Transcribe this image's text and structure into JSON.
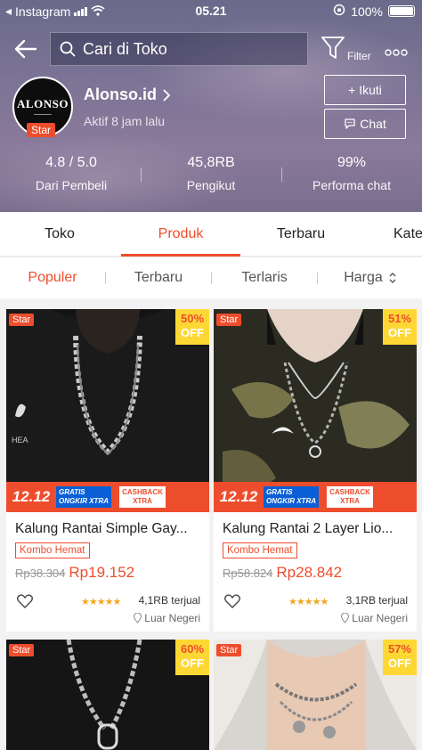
{
  "status_bar": {
    "carrier": "Instagram",
    "time": "05.21",
    "battery": "100%"
  },
  "header": {
    "search_placeholder": "Cari di Toko",
    "filter_label": "Filter",
    "shop_name": "Alonso.id",
    "shop_logo_text": "ALONSO",
    "shop_badge": "Star",
    "active_status": "Aktif 8 jam lalu",
    "follow_label": "+ Ikuti",
    "chat_label": "Chat",
    "stats": [
      {
        "value": "4.8 / 5.0",
        "label": "Dari Pembeli"
      },
      {
        "value": "45,8RB",
        "label": "Pengikut"
      },
      {
        "value": "99%",
        "label": "Performa chat"
      }
    ]
  },
  "tabs": [
    "Toko",
    "Produk",
    "Terbaru",
    "Kate"
  ],
  "active_tab": "Produk",
  "sort_options": [
    "Populer",
    "Terbaru",
    "Terlaris",
    "Harga"
  ],
  "active_sort": "Populer",
  "products": [
    {
      "star": "Star",
      "discount": "50%",
      "off": "OFF",
      "promo_date": "12.12",
      "promo_shipping": "GRATIS ONGKIR XTRA",
      "promo_cashback": "CASHBACK XTRA",
      "title": "Kalung Rantai Simple Gay...",
      "bundle": "Kombo Hemat",
      "old_price": "Rp38.304",
      "price": "Rp19.152",
      "rating_stars": 4.5,
      "sold": "4,1RB terjual",
      "location": "Luar Negeri"
    },
    {
      "star": "Star",
      "discount": "51%",
      "off": "OFF",
      "promo_date": "12.12",
      "promo_shipping": "GRATIS ONGKIR XTRA",
      "promo_cashback": "CASHBACK XTRA",
      "title": "Kalung Rantai 2 Layer Lio...",
      "bundle": "Kombo Hemat",
      "old_price": "Rp58.824",
      "price": "Rp28.842",
      "rating_stars": 4.5,
      "sold": "3,1RB terjual",
      "location": "Luar Negeri"
    },
    {
      "star": "Star",
      "discount": "60%",
      "off": "OFF"
    },
    {
      "star": "Star",
      "discount": "57%",
      "off": "OFF"
    }
  ],
  "colors": {
    "accent": "#ee4d2d",
    "discount_bg": "#fdd835",
    "star_rating": "#f5a623"
  }
}
